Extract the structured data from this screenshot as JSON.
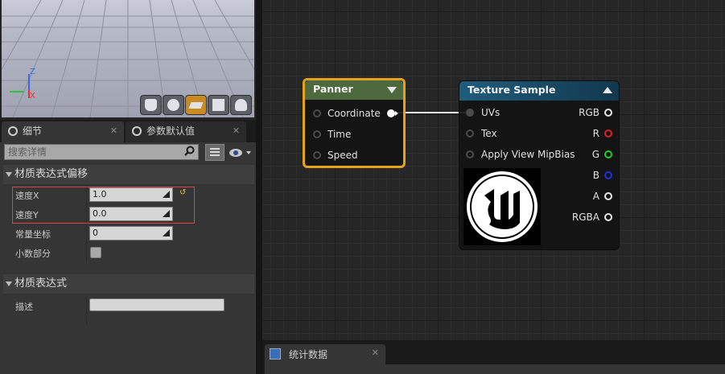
{
  "viewport": {
    "axis_z": "Z",
    "axis_x": "X",
    "buttons": [
      "cylinder",
      "sphere",
      "plane",
      "cube",
      "custom-mesh"
    ],
    "active_button": "plane"
  },
  "tabs": [
    {
      "label": "细节",
      "close": "✕"
    },
    {
      "label": "参数默认值",
      "close": "✕"
    }
  ],
  "search": {
    "placeholder": "搜索详情"
  },
  "categories": {
    "offset": "材质表达式偏移",
    "expression": "材质表达式"
  },
  "properties": {
    "speed_x": {
      "label": "速度X",
      "value": "1.0"
    },
    "speed_y": {
      "label": "速度Y",
      "value": "0.0"
    },
    "const_coord": {
      "label": "常量坐标",
      "value": "0"
    },
    "fractional": {
      "label": "小数部分"
    },
    "desc": {
      "label": "描述",
      "value": ""
    }
  },
  "panner_node": {
    "title": "Panner",
    "inputs": [
      "Coordinate",
      "Time",
      "Speed"
    ]
  },
  "texture_node": {
    "title": "Texture Sample",
    "inputs": [
      "UVs",
      "Tex",
      "Apply View MipBias"
    ],
    "outputs": [
      "RGB",
      "R",
      "G",
      "B",
      "A",
      "RGBA"
    ],
    "output_colors": [
      "#e8e8e8",
      "#e02020",
      "#20d020",
      "#2030e0",
      "#e8e8e8",
      "#e8e8e8"
    ],
    "title_color": "#1f5d7d"
  },
  "stats": {
    "label": "统计数据",
    "close": "✕"
  },
  "colors": {
    "panner_border": "#e8a21a",
    "panner_title": "#4d6a3e",
    "highlight_box": "#e0404c"
  }
}
